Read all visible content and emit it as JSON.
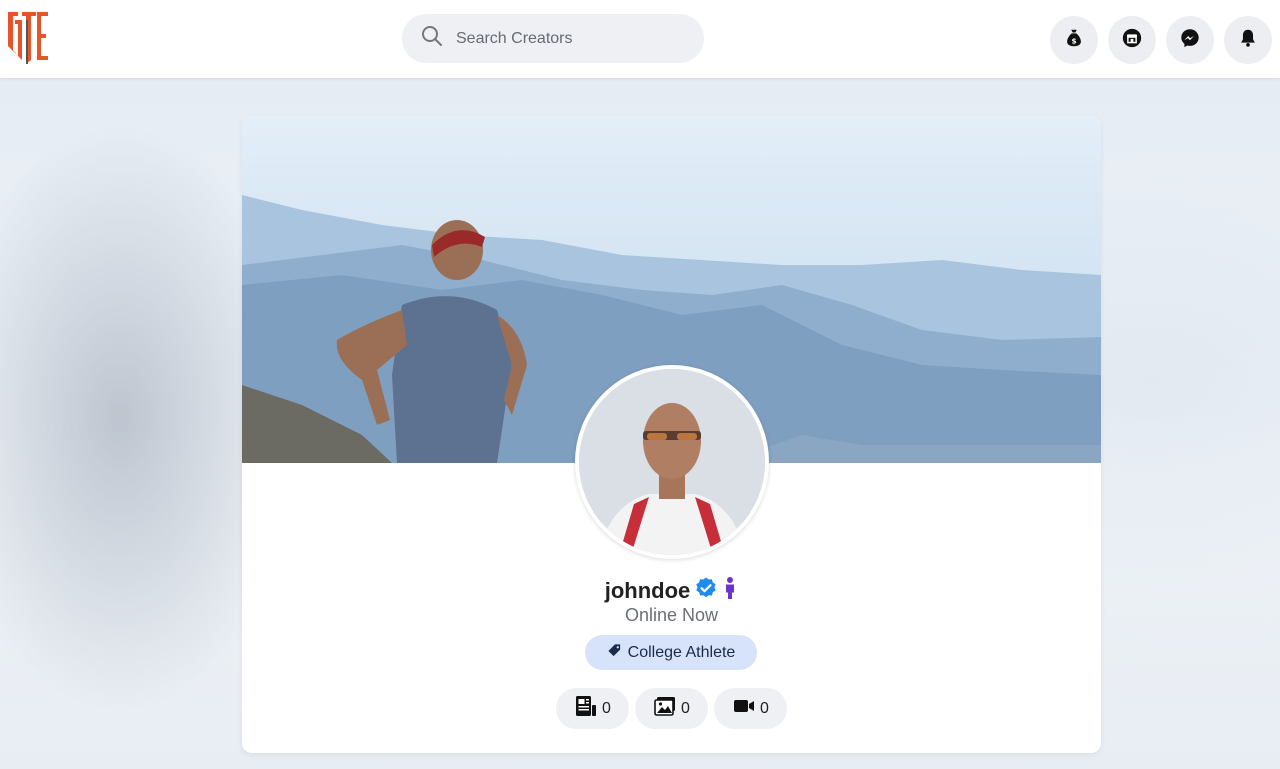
{
  "header": {
    "logo_alt": "GTE",
    "search": {
      "placeholder": "Search Creators",
      "value": ""
    },
    "icons": [
      "money-bag-icon",
      "store-icon",
      "messenger-icon",
      "bell-icon"
    ]
  },
  "profile": {
    "username": "johndoe",
    "verified": true,
    "status": "Online Now",
    "category": "College Athlete",
    "stats": [
      {
        "icon": "posts-icon",
        "count": "0"
      },
      {
        "icon": "photos-icon",
        "count": "0"
      },
      {
        "icon": "videos-icon",
        "count": "0"
      }
    ]
  },
  "colors": {
    "logo_orange": "#e8542a",
    "verified_blue": "#1d8cf0",
    "badge_purple": "#6a35c8",
    "tag_bg": "#d7e3fb"
  }
}
